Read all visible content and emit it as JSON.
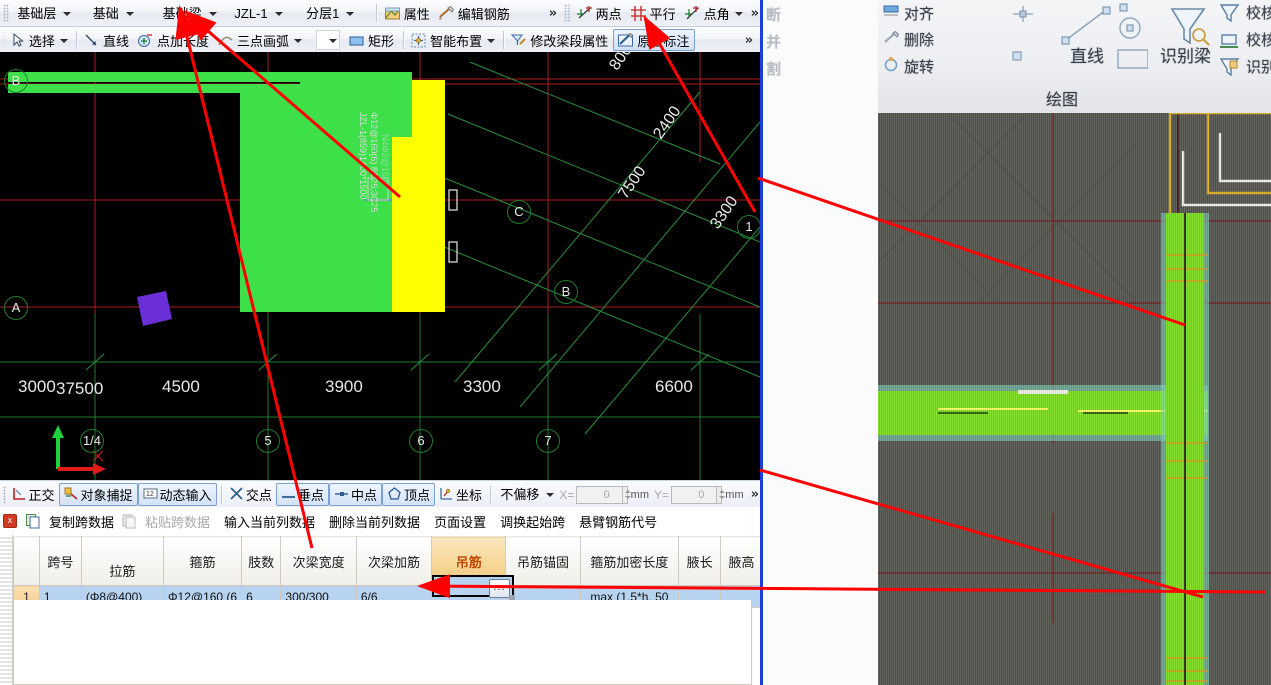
{
  "toolbar_row1": {
    "selectors": [
      {
        "name": "floor-selector",
        "value": "基础层"
      },
      {
        "name": "category-selector",
        "value": "基础"
      },
      {
        "name": "component-type-selector",
        "value": "基础梁"
      },
      {
        "name": "component-name-selector",
        "value": "JZL-1"
      },
      {
        "name": "layer-selector",
        "value": "分层1"
      }
    ],
    "buttons": [
      {
        "name": "properties-button",
        "label": "属性",
        "icon": "properties-icon"
      },
      {
        "name": "edit-rebar-button",
        "label": "编辑钢筋",
        "icon": "pencil-icon"
      }
    ],
    "overflow": "»",
    "right_buttons": [
      {
        "name": "two-point-button",
        "label": "两点",
        "icon": "two-point-icon"
      },
      {
        "name": "parallel-button",
        "label": "平行",
        "icon": "parallel-icon"
      },
      {
        "name": "point-angle-button",
        "label": "点角",
        "icon": "point-angle-icon",
        "dropdown": true
      }
    ],
    "right_overflow": "»"
  },
  "toolbar_row2": {
    "buttons": [
      {
        "name": "select-button",
        "label": "选择",
        "icon": "cursor-icon",
        "dropdown": true
      },
      {
        "name": "line-button",
        "label": "直线",
        "icon": "line-icon"
      },
      {
        "name": "point-add-length-button",
        "label": "点加长度",
        "icon": "point-length-icon"
      },
      {
        "name": "three-point-arc-button",
        "label": "三点画弧",
        "icon": "arc-icon",
        "dropdown": true
      },
      {
        "name": "rectangle-button",
        "label": "矩形",
        "icon": "rectangle-icon"
      },
      {
        "name": "smart-layout-button",
        "label": "智能布置",
        "icon": "smart-layout-icon",
        "dropdown": true
      },
      {
        "name": "modify-beam-segment-button",
        "label": "修改梁段属性",
        "icon": "modify-beam-icon"
      },
      {
        "name": "insitu-annotation-button",
        "label": "原位标注",
        "icon": "annotate-icon",
        "dropdown": true,
        "selected": true
      }
    ],
    "empty_combo_value": "",
    "overflow": "»"
  },
  "canvas": {
    "axis_label": "37500",
    "dim_labels_bottom": [
      "3000",
      "4500",
      "3900",
      "3300",
      "6600"
    ],
    "grid_bubbles_bottom": [
      "1/4",
      "5",
      "6",
      "7"
    ],
    "grid_bubbles_left": [
      "B",
      "A"
    ],
    "grid_bubbles_right": [
      "C",
      "B",
      "1"
    ],
    "rotated_dims": [
      "800",
      "2400",
      "7500",
      "3300"
    ],
    "beam_annotation": [
      "JZL-1(859)1400*1500",
      "Φ12@160(6) 8C25;3C25",
      "N4Φ2@150"
    ]
  },
  "status_bar": {
    "buttons": [
      {
        "name": "ortho-button",
        "label": "正交",
        "icon": "ortho-icon",
        "active": false
      },
      {
        "name": "object-snap-button",
        "label": "对象捕捉",
        "icon": "snap-icon",
        "active": true
      },
      {
        "name": "dynamic-input-button",
        "label": "动态输入",
        "icon": "dynamic-input-icon",
        "active": true
      },
      {
        "name": "intersection-snap-button",
        "label": "交点",
        "icon": "intersection-icon",
        "active": false
      },
      {
        "name": "perpendicular-snap-button",
        "label": "垂点",
        "icon": "perpendicular-icon",
        "active": true
      },
      {
        "name": "midpoint-snap-button",
        "label": "中点",
        "icon": "midpoint-icon",
        "active": true
      },
      {
        "name": "vertex-snap-button",
        "label": "顶点",
        "icon": "vertex-icon",
        "active": true
      },
      {
        "name": "coordinate-button",
        "label": "坐标",
        "icon": "coordinate-icon",
        "active": false
      }
    ],
    "offset_mode": "不偏移",
    "x_label": "X=",
    "x_value": "0",
    "y_label": "Y=",
    "y_value": "0",
    "unit": "mm",
    "overflow": "»"
  },
  "command_bar": {
    "items": [
      {
        "name": "copy-span-data",
        "label": "复制跨数据",
        "disabled": false,
        "icon": "copy-icon"
      },
      {
        "name": "paste-span-data",
        "label": "粘贴跨数据",
        "disabled": true,
        "icon": "paste-icon"
      },
      {
        "name": "input-current-column-data",
        "label": "输入当前列数据",
        "disabled": false
      },
      {
        "name": "delete-current-column-data",
        "label": "删除当前列数据",
        "disabled": false
      },
      {
        "name": "page-setup",
        "label": "页面设置",
        "disabled": false
      },
      {
        "name": "swap-start-span",
        "label": "调换起始跨",
        "disabled": false
      },
      {
        "name": "cantilever-rebar-code",
        "label": "悬臂钢筋代号",
        "disabled": false
      }
    ],
    "close_badge": "x"
  },
  "table": {
    "headers": [
      {
        "name": "col-span-no",
        "label": "跨号",
        "width": 44,
        "split": false,
        "highlight": false
      },
      {
        "name": "col-tie-rebar",
        "label": "拉筋",
        "width": 83,
        "split": true,
        "highlight": false
      },
      {
        "name": "col-stirrup",
        "label": "箍筋",
        "width": 63,
        "split": false,
        "highlight": false
      },
      {
        "name": "col-legs",
        "label": "肢数",
        "width": 41,
        "split": false,
        "highlight": false
      },
      {
        "name": "col-secondary-beam-width",
        "label": "次梁宽度",
        "width": 77,
        "split": false,
        "highlight": false
      },
      {
        "name": "col-secondary-beam-rebar",
        "label": "次梁加筋",
        "width": 80,
        "split": false,
        "highlight": false
      },
      {
        "name": "col-hanging-rebar",
        "label": "吊筋",
        "width": 80,
        "split": false,
        "highlight": true
      },
      {
        "name": "col-hanging-anchor",
        "label": "吊筋锚固",
        "width": 80,
        "split": false,
        "highlight": false
      },
      {
        "name": "col-stirrup-dense-length",
        "label": "箍筋加密长度",
        "width": 99,
        "split": false,
        "highlight": false
      },
      {
        "name": "col-haunch-length",
        "label": "腋长",
        "width": 44,
        "split": false,
        "highlight": false
      },
      {
        "name": "col-haunch-height",
        "label": "腋高",
        "width": 44,
        "split": false,
        "highlight": false
      }
    ],
    "rows": [
      {
        "row_number": "1",
        "cells": [
          "1",
          "(Φ8@400)",
          "Φ12@160 (6",
          "6",
          "300/300",
          "6/6",
          "",
          "",
          "max (1.5*h, 50",
          "",
          ""
        ]
      }
    ],
    "editing_cell": {
      "column": "col-hanging-rebar",
      "value": "",
      "ellipsis_label": "..."
    }
  },
  "photo_panel": {
    "ribbon_left_partial": [
      "断",
      "并",
      "割"
    ],
    "ribbon_items": [
      {
        "name": "align-button",
        "label": "对齐",
        "dropdown": true
      },
      {
        "name": "delete-button",
        "label": "删除"
      },
      {
        "name": "rotate-button",
        "label": "旋转"
      }
    ],
    "draw_group_label": "直线",
    "draw_group_title": "绘图",
    "identify_beam_label": "识别梁",
    "right_items": [
      {
        "name": "check-beam-button",
        "label": "校核梁"
      },
      {
        "name": "check-insitu-button",
        "label": "校核原"
      },
      {
        "name": "identify-beam-rebar-button",
        "label": "识别梁"
      },
      {
        "name": "identify-label",
        "label": "识别"
      }
    ]
  },
  "colors": {
    "canvas_bg": "#000000",
    "beam_green": "#3ee04a",
    "beam_yellow": "#ffff00",
    "selected_purple": "#6a2fd6",
    "grid_red": "#b02020",
    "grid_green": "#1d7d2e",
    "annotation_red": "#ff0000",
    "highlight_orange": "#c24a00",
    "row_select_blue": "#b8d3ef"
  }
}
